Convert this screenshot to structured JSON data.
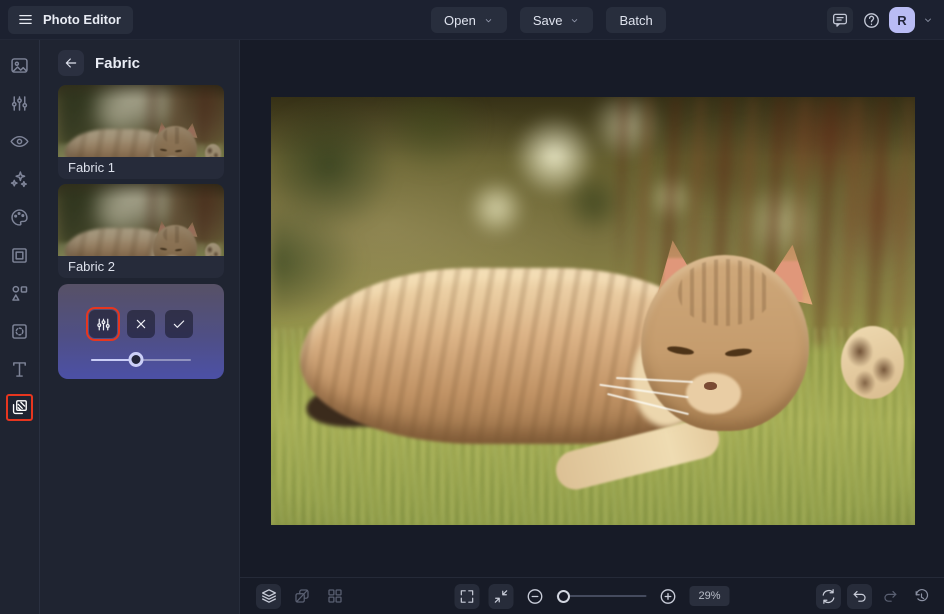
{
  "app": {
    "title": "Photo Editor"
  },
  "topbar": {
    "open": "Open",
    "save": "Save",
    "batch": "Batch",
    "avatar_initial": "R",
    "icons": [
      "menu-icon",
      "message-icon",
      "help-icon",
      "chevron-down-icon"
    ]
  },
  "toolrail": {
    "active_item": "overlays",
    "items": [
      {
        "name": "image"
      },
      {
        "name": "adjust"
      },
      {
        "name": "eye"
      },
      {
        "name": "effects"
      },
      {
        "name": "palette"
      },
      {
        "name": "frame"
      },
      {
        "name": "elements"
      },
      {
        "name": "border"
      },
      {
        "name": "text"
      },
      {
        "name": "overlays"
      }
    ]
  },
  "panel": {
    "title": "Fabric",
    "items": [
      {
        "label": "Fabric 1"
      },
      {
        "label": "Fabric 2"
      }
    ],
    "editor": {
      "buttons": [
        "adjust",
        "cancel",
        "apply"
      ],
      "flagged_button": "adjust",
      "slider_percent": 45
    }
  },
  "canvas": {
    "image_alt": "Sleeping tabby cat lying on sunlit grass"
  },
  "statusbar": {
    "zoom": "29%",
    "zoom_slider_percent": 8,
    "left_icons": [
      "layers",
      "compare",
      "grid"
    ],
    "right_icons": [
      "refresh",
      "undo",
      "redo",
      "history"
    ]
  },
  "colors": {
    "accent_red": "#e7361f",
    "avatar_bg": "#b9bcf4",
    "editor_gradient_top": "#575166",
    "editor_gradient_bottom": "#4c50a6",
    "topbar_bg": "#1c2130",
    "panel_bg": "#1f2431",
    "workspace_bg": "#171b27"
  }
}
